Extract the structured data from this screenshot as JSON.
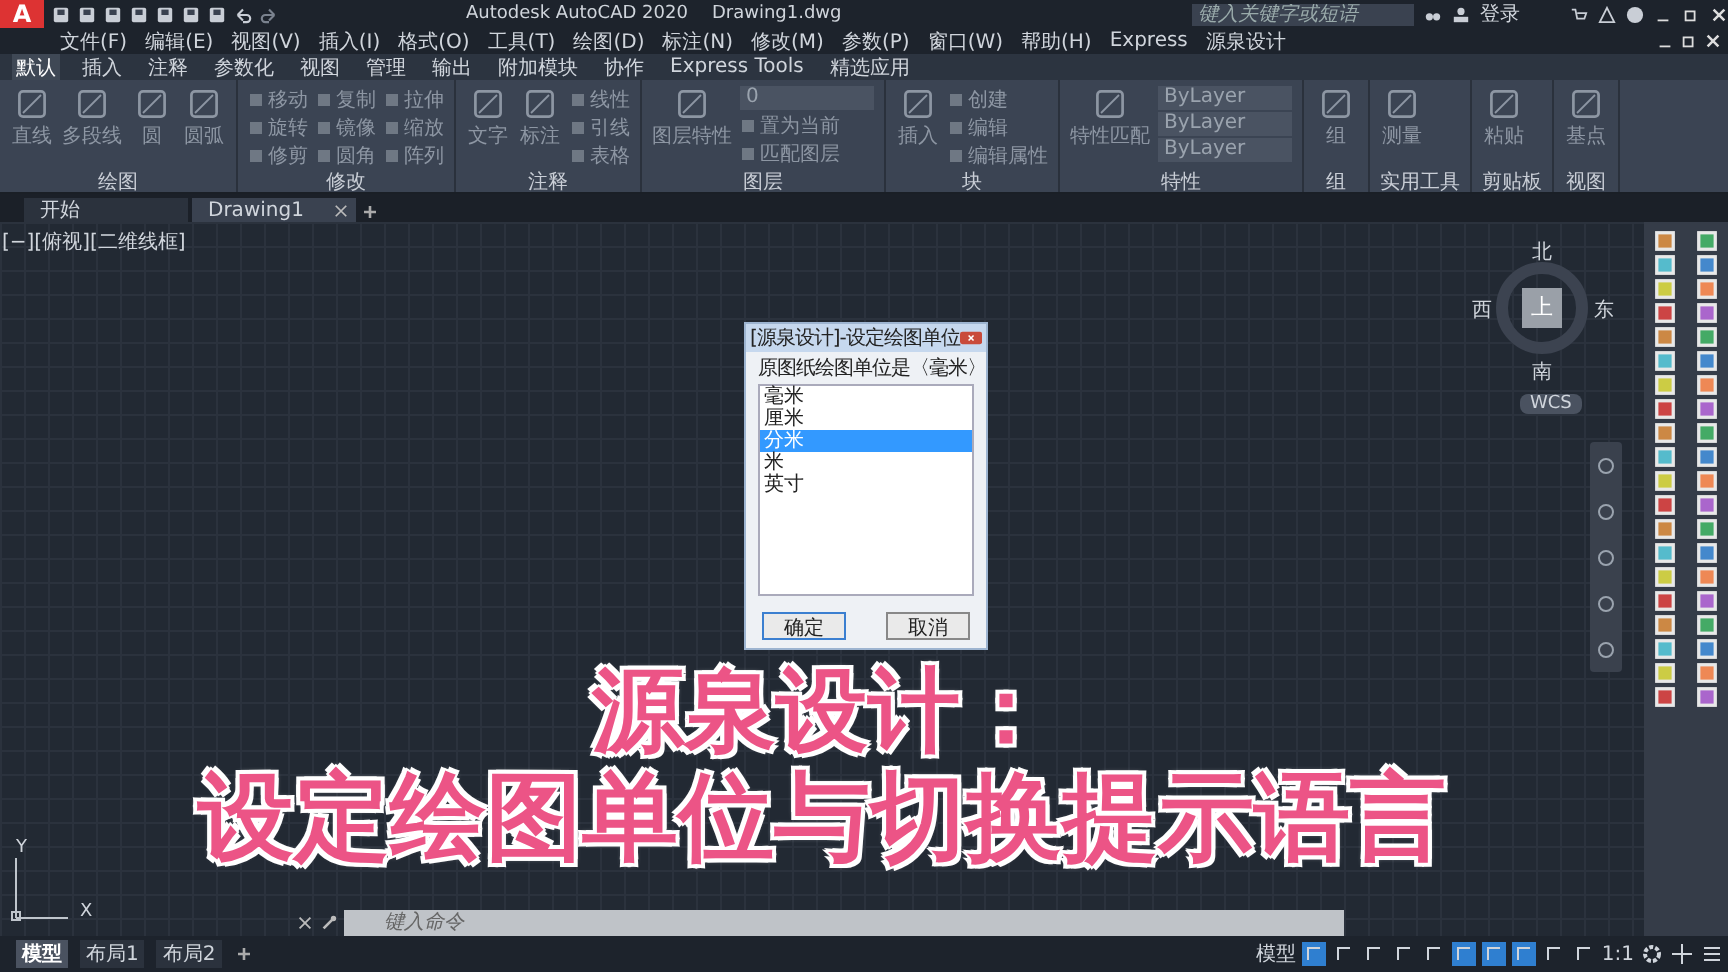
{
  "title_bar": {
    "logo": "A",
    "app_title": "Autodesk AutoCAD 2020",
    "file_name": "Drawing1.dwg",
    "search": {
      "placeholder": "键入关键字或短语"
    },
    "login": "登录"
  },
  "menu_bar": [
    "文件(F)",
    "编辑(E)",
    "视图(V)",
    "插入(I)",
    "格式(O)",
    "工具(T)",
    "绘图(D)",
    "标注(N)",
    "修改(M)",
    "参数(P)",
    "窗口(W)",
    "帮助(H)",
    "Express",
    "源泉设计"
  ],
  "ribbon_tabs": [
    {
      "label": "默认",
      "selected": true
    },
    {
      "label": "插入",
      "selected": false
    },
    {
      "label": "注释",
      "selected": false
    },
    {
      "label": "参数化",
      "selected": false
    },
    {
      "label": "视图",
      "selected": false
    },
    {
      "label": "管理",
      "selected": false
    },
    {
      "label": "输出",
      "selected": false
    },
    {
      "label": "附加模块",
      "selected": false
    },
    {
      "label": "协作",
      "selected": false
    },
    {
      "label": "Express Tools",
      "selected": false
    },
    {
      "label": "精选应用",
      "selected": false
    }
  ],
  "ribbon_panels": [
    {
      "title": "绘图",
      "large": [
        "直线",
        "多段线",
        "圆",
        "圆弧"
      ]
    },
    {
      "title": "修改",
      "small": [
        "移动",
        "旋转",
        "修剪",
        "复制",
        "镜像",
        "圆角",
        "拉伸",
        "缩放",
        "阵列"
      ]
    },
    {
      "title": "注释",
      "large": [
        "文字",
        "标注"
      ],
      "small": [
        "线性",
        "引线",
        "表格"
      ]
    },
    {
      "title": "图层",
      "large": [
        "图层特性"
      ],
      "small": [
        "置为当前",
        "匹配图层"
      ],
      "dropdowns": [
        "0"
      ]
    },
    {
      "title": "块",
      "large": [
        "插入"
      ],
      "small": [
        "创建",
        "编辑",
        "编辑属性"
      ]
    },
    {
      "title": "特性",
      "large": [
        "特性匹配"
      ],
      "dropdowns": [
        "ByLayer",
        "ByLayer",
        "ByLayer"
      ]
    },
    {
      "title": "组",
      "large": [
        "组"
      ]
    },
    {
      "title": "实用工具",
      "large": [
        "测量"
      ]
    },
    {
      "title": "剪贴板",
      "large": [
        "粘贴"
      ]
    },
    {
      "title": "视图",
      "large": [
        "基点"
      ]
    }
  ],
  "doc_tabs": [
    {
      "label": "开始",
      "selected": false
    },
    {
      "label": "Drawing1",
      "selected": true
    }
  ],
  "viewport_label": "[−][俯视][二维线框]",
  "dialog": {
    "title": "[源泉设计]-设定绘图单位",
    "prompt": "原图纸绘图单位是〈毫米〉",
    "units": [
      {
        "label": "毫米",
        "selected": false
      },
      {
        "label": "厘米",
        "selected": false
      },
      {
        "label": "分米",
        "selected": true
      },
      {
        "label": "米",
        "selected": false
      },
      {
        "label": "英寸",
        "selected": false
      }
    ],
    "buttons": [
      "确定",
      "取消"
    ]
  },
  "view_cube": {
    "north": "北",
    "east": "东",
    "south": "南",
    "west": "西",
    "top": "上",
    "wcs": "WCS"
  },
  "caption": [
    "源泉设计：",
    "设定绘图单位与切换提示语言"
  ],
  "ucs": {
    "x": "X",
    "y": "Y"
  },
  "command_line": {
    "placeholder": "键入命令"
  },
  "layout_tabs": [
    {
      "label": "模型",
      "selected": true
    },
    {
      "label": "布局1",
      "selected": false
    },
    {
      "label": "布局2",
      "selected": false
    }
  ],
  "status_bar": {
    "space": "模型",
    "scale": "1:1",
    "toggles": [
      {
        "on": true
      },
      {
        "on": false
      },
      {
        "on": false
      },
      {
        "on": false
      },
      {
        "on": false
      },
      {
        "on": true
      },
      {
        "on": true
      },
      {
        "on": true
      },
      {
        "on": false
      },
      {
        "on": false
      }
    ]
  }
}
